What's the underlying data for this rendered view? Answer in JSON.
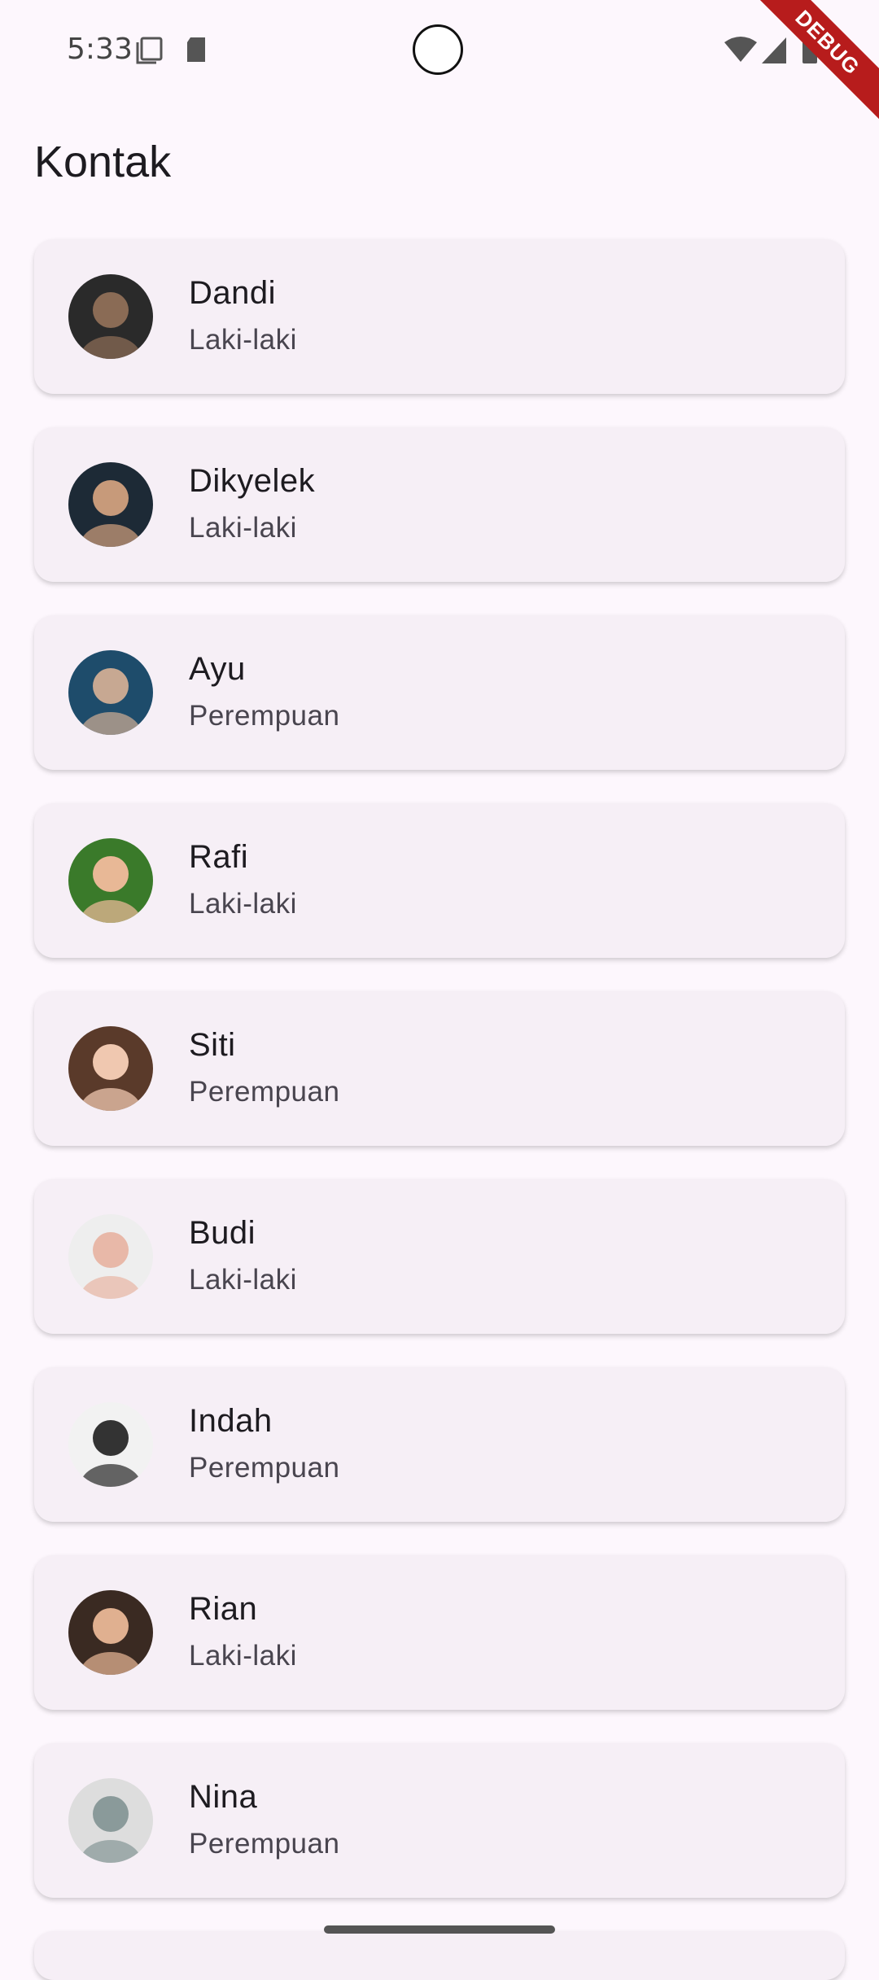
{
  "status_bar": {
    "time": "5:33",
    "icons": [
      "screenshot-icon",
      "sd-card-icon",
      "wifi-icon",
      "signal-icon",
      "battery-icon"
    ],
    "debug_label": "DEBUG"
  },
  "app_bar": {
    "title": "Kontak"
  },
  "contacts": [
    {
      "name": "Dandi",
      "gender": "Laki-laki",
      "avatar_colors": [
        "#2a2a2a",
        "#8a6b55"
      ]
    },
    {
      "name": "Dikyelek",
      "gender": "Laki-laki",
      "avatar_colors": [
        "#1d2a36",
        "#c79a7a"
      ]
    },
    {
      "name": "Ayu",
      "gender": "Perempuan",
      "avatar_colors": [
        "#1e4c6b",
        "#c7a892"
      ]
    },
    {
      "name": "Rafi",
      "gender": "Laki-laki",
      "avatar_colors": [
        "#3a7a2a",
        "#e8b896"
      ]
    },
    {
      "name": "Siti",
      "gender": "Perempuan",
      "avatar_colors": [
        "#5a3a2a",
        "#f0c8b0"
      ]
    },
    {
      "name": "Budi",
      "gender": "Laki-laki",
      "avatar_colors": [
        "#eeeeee",
        "#e8b8a8"
      ]
    },
    {
      "name": "Indah",
      "gender": "Perempuan",
      "avatar_colors": [
        "#f2f2f2",
        "#333333"
      ]
    },
    {
      "name": "Rian",
      "gender": "Laki-laki",
      "avatar_colors": [
        "#3a2a22",
        "#e0b090"
      ]
    },
    {
      "name": "Nina",
      "gender": "Perempuan",
      "avatar_colors": [
        "#dddddd",
        "#8a9a9a"
      ]
    }
  ]
}
